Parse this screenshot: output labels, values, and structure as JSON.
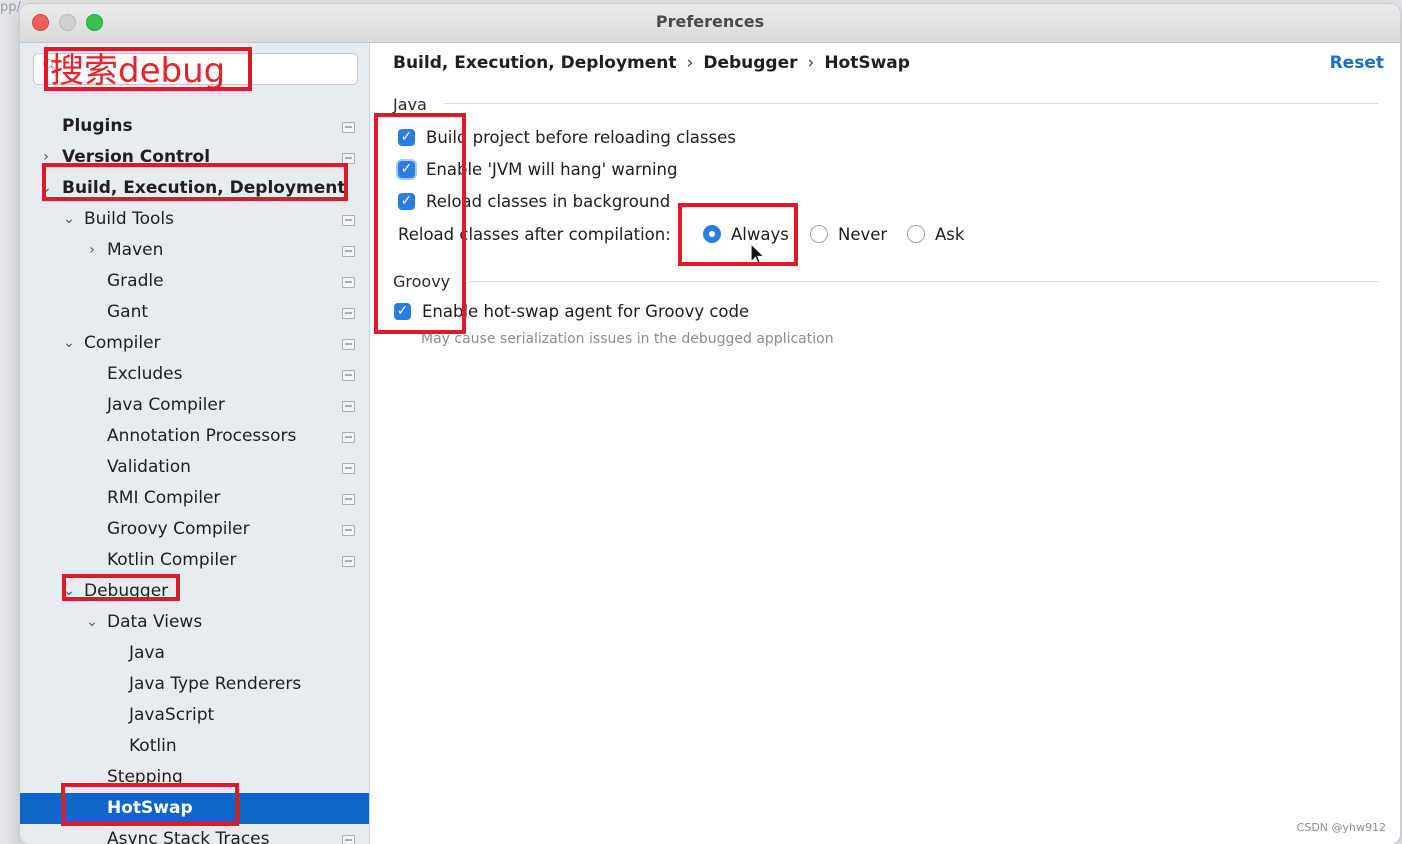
{
  "window": {
    "title": "Preferences"
  },
  "search": {
    "placeholder": "",
    "annotation": "搜索debug"
  },
  "sidebar": {
    "items": [
      {
        "label": "Plugins"
      },
      {
        "label": "Version Control"
      },
      {
        "label": "Build, Execution, Deployment"
      },
      {
        "label": "Build Tools"
      },
      {
        "label": "Maven"
      },
      {
        "label": "Gradle"
      },
      {
        "label": "Gant"
      },
      {
        "label": "Compiler"
      },
      {
        "label": "Excludes"
      },
      {
        "label": "Java Compiler"
      },
      {
        "label": "Annotation Processors"
      },
      {
        "label": "Validation"
      },
      {
        "label": "RMI Compiler"
      },
      {
        "label": "Groovy Compiler"
      },
      {
        "label": "Kotlin Compiler"
      },
      {
        "label": "Debugger"
      },
      {
        "label": "Data Views"
      },
      {
        "label": "Java"
      },
      {
        "label": "Java Type Renderers"
      },
      {
        "label": "JavaScript"
      },
      {
        "label": "Kotlin"
      },
      {
        "label": "Stepping"
      },
      {
        "label": "HotSwap"
      },
      {
        "label": "Async Stack Traces"
      }
    ],
    "selected": "HotSwap"
  },
  "breadcrumb": {
    "part1": "Build, Execution, Deployment",
    "part2": "Debugger",
    "part3": "HotSwap",
    "separator": "›"
  },
  "reset_label": "Reset",
  "java_section": {
    "title": "Java",
    "build_project": {
      "label": "Build project before reloading classes",
      "checked": true
    },
    "jvm_hang": {
      "label": "Enable 'JVM will hang' warning",
      "checked": true
    },
    "reload_background": {
      "label": "Reload classes in background",
      "checked": true
    },
    "reload_after": {
      "label": "Reload classes after compilation:",
      "options": [
        "Always",
        "Never",
        "Ask"
      ],
      "selected": "Always"
    }
  },
  "groovy_section": {
    "title": "Groovy",
    "hotswap_agent": {
      "label": "Enable hot-swap agent for Groovy code",
      "checked": true
    },
    "hint": "May cause serialization issues in the debugged application"
  },
  "watermark": "CSDN @yhw912",
  "corner_text": "pp/...",
  "colors": {
    "accent": "#2a7de1",
    "selection": "#0f66c7",
    "annotation": "#e0192a",
    "link": "#1a6fc4"
  }
}
